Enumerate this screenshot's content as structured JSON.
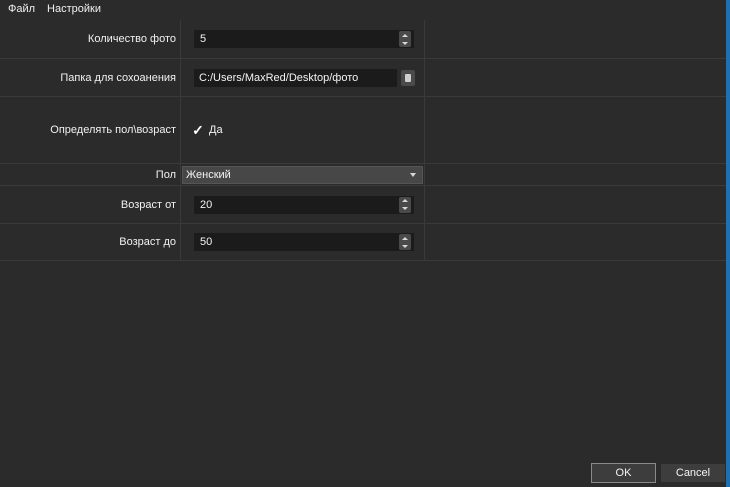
{
  "menubar": {
    "file": "Файл",
    "settings": "Настройки"
  },
  "form": {
    "photo_count": {
      "label": "Количество фото",
      "value": "5"
    },
    "save_folder": {
      "label": "Папка для сохоанения",
      "value": "C:/Users/MaxRed/Desktop/фото"
    },
    "detect_gender_age": {
      "label": "Определять пол\\возраст",
      "checkbox_label": "Да",
      "checked": true
    },
    "gender": {
      "label": "Пол",
      "selected": "Женский"
    },
    "age_from": {
      "label": "Возраст от",
      "value": "20"
    },
    "age_to": {
      "label": "Возраст до",
      "value": "50"
    }
  },
  "buttons": {
    "ok": "OK",
    "cancel": "Cancel"
  },
  "colors": {
    "background": "#2b2b2b",
    "input_background": "#1b1b1b",
    "accent_edge": "#1f6fb3"
  },
  "icons": [
    "folder-icon",
    "checkmark-icon",
    "chevron-down-icon",
    "spin-up-icon",
    "spin-down-icon"
  ]
}
